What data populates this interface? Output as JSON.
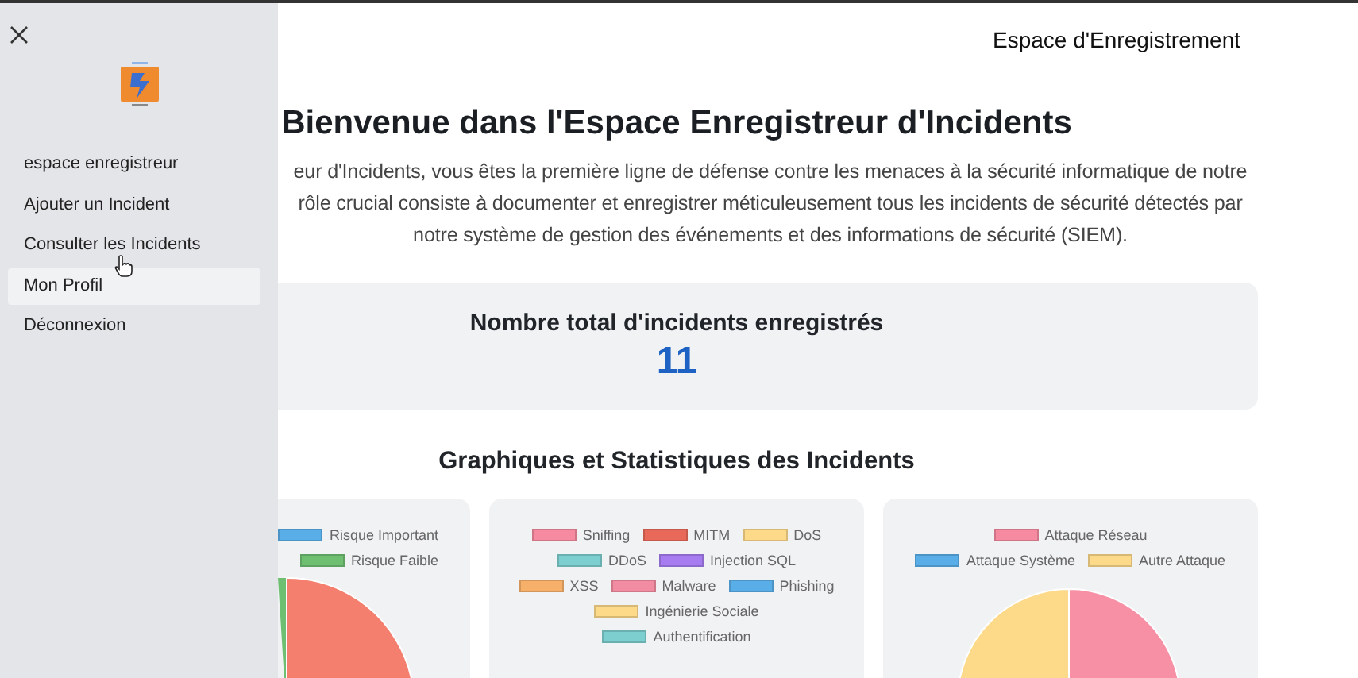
{
  "header": {
    "title": "Espace d'Enregistrement"
  },
  "sidebar": {
    "items": [
      {
        "label": "espace enregistreur",
        "highlighted": false
      },
      {
        "label": "Ajouter un Incident",
        "highlighted": false
      },
      {
        "label": "Consulter les Incidents",
        "highlighted": false
      },
      {
        "label": "Mon Profil",
        "highlighted": true
      },
      {
        "label": "Déconnexion",
        "highlighted": false
      }
    ]
  },
  "welcome": {
    "title": "Bienvenue dans l'Espace Enregistreur d'Incidents",
    "paragraph_lines": [
      "eur d'Incidents, vous êtes la première ligne de défense contre les menaces à la sécurité informatique de notre",
      "rôle crucial consiste à documenter et enregistrer méticuleusement tous les incidents de sécurité détectés par",
      "notre système de gestion des événements et des informations de sécurité (SIEM)."
    ]
  },
  "total": {
    "label": "Nombre total d'incidents enregistrés",
    "value": "11"
  },
  "charts_section": {
    "title": "Graphiques et Statistiques des Incidents",
    "charts": [
      {
        "legend_rows": [
          [
            {
              "label": "Risque Important",
              "color": "#5aaee8"
            }
          ],
          [
            {
              "label": "Risque Faible",
              "color": "#6fbf73"
            }
          ]
        ]
      },
      {
        "legend_rows": [
          [
            {
              "label": "Sniffing",
              "color": "#f58aa0"
            },
            {
              "label": "MITM",
              "color": "#e8695a"
            },
            {
              "label": "DoS",
              "color": "#fdd98a"
            }
          ],
          [
            {
              "label": "DDoS",
              "color": "#7dcfcf"
            },
            {
              "label": "Injection SQL",
              "color": "#a77cf0"
            }
          ],
          [
            {
              "label": "XSS",
              "color": "#f7b06a"
            },
            {
              "label": "Malware",
              "color": "#f28ca2"
            },
            {
              "label": "Phishing",
              "color": "#5aaee8"
            }
          ],
          [
            {
              "label": "Ingénierie Sociale",
              "color": "#fdd98a"
            }
          ],
          [
            {
              "label": "Authentification",
              "color": "#7dcfcf"
            }
          ]
        ]
      },
      {
        "legend_rows": [
          [
            {
              "label": "Attaque Réseau",
              "color": "#f58aa0"
            }
          ],
          [
            {
              "label": "Attaque Système",
              "color": "#5aaee8"
            },
            {
              "label": "Autre Attaque",
              "color": "#fdd98a"
            }
          ]
        ]
      }
    ]
  }
}
